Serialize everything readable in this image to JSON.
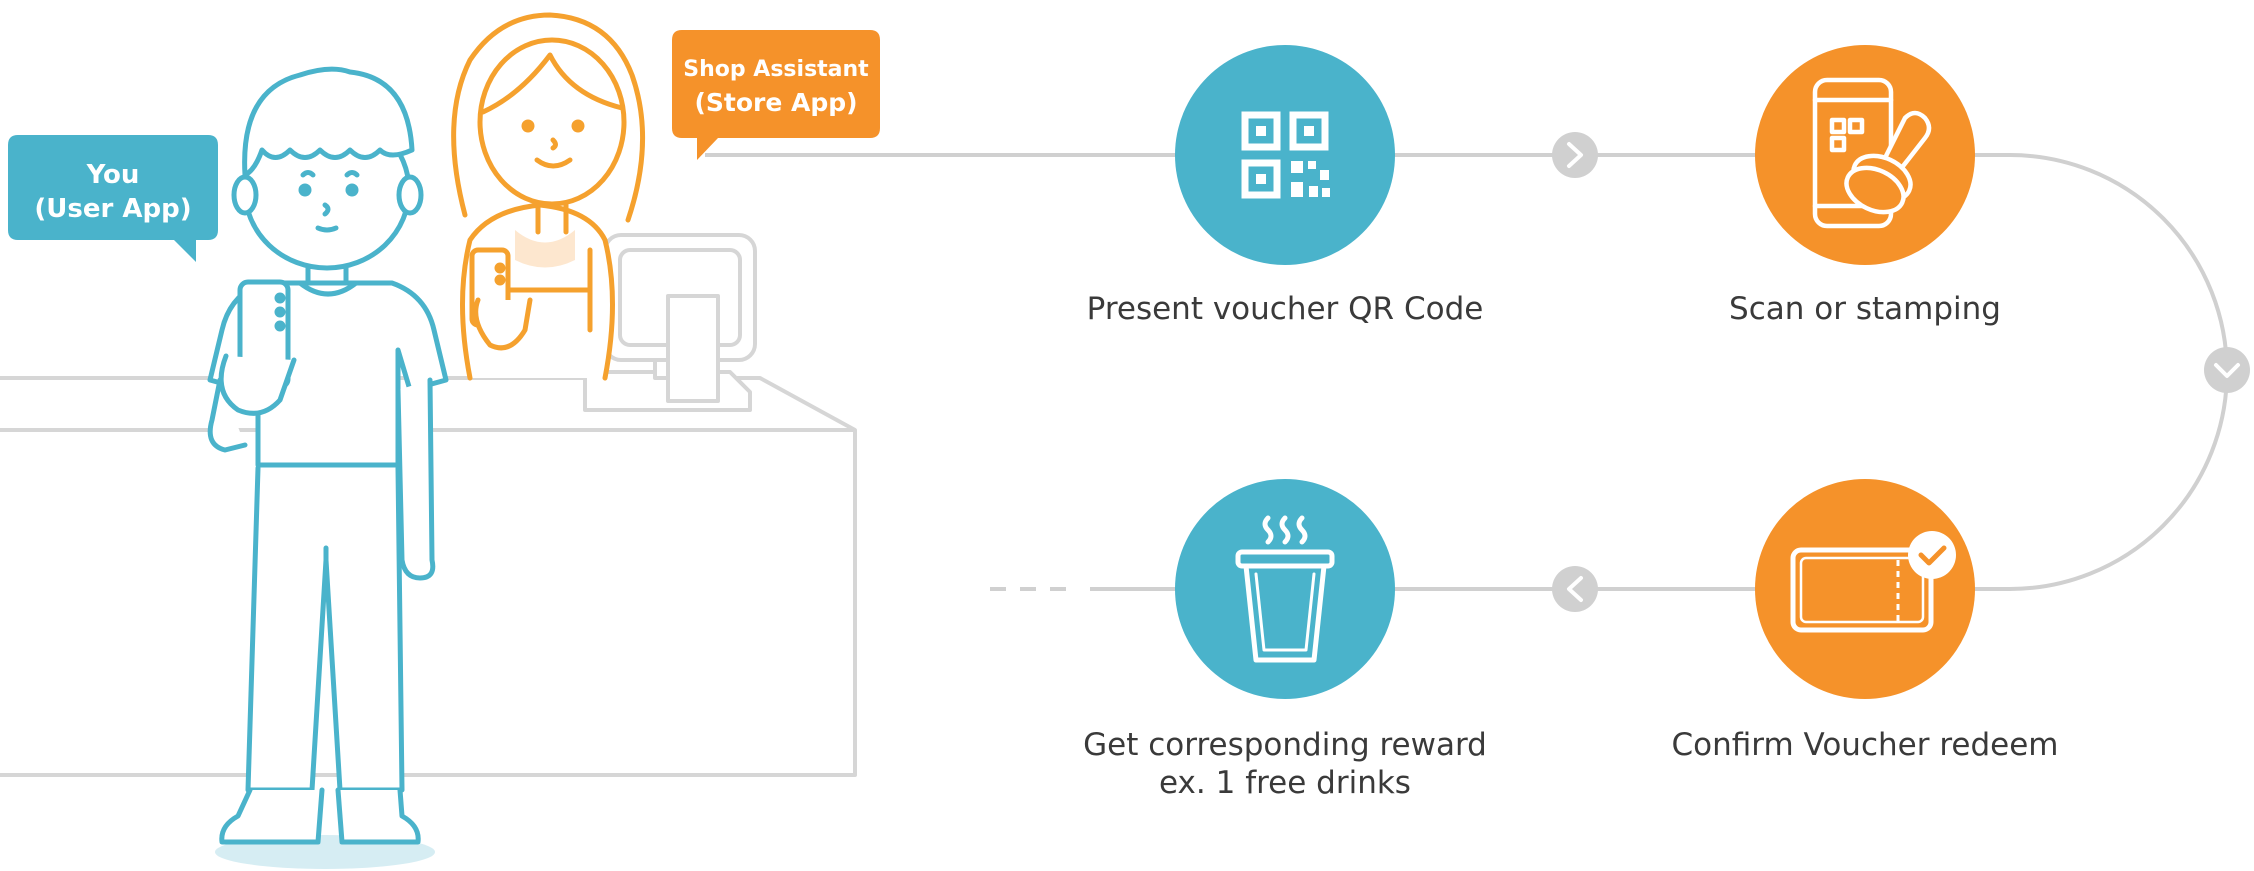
{
  "roles": {
    "user": {
      "line1": "You",
      "line2": "(User App)"
    },
    "shop": {
      "line1": "Shop Assistant",
      "line2": "(Store App)"
    }
  },
  "steps": [
    {
      "label": "Present voucher QR Code",
      "sublabel": "",
      "icon": "qr-code-icon",
      "color": "#4ab3cb"
    },
    {
      "label": "Scan or stamping",
      "sublabel": "",
      "icon": "phone-stamp-icon",
      "color": "#f5922a"
    },
    {
      "label": "Confirm Voucher redeem",
      "sublabel": "",
      "icon": "voucher-check-icon",
      "color": "#f5922a"
    },
    {
      "label": "Get corresponding reward",
      "sublabel": "ex. 1 free drinks",
      "icon": "hot-drink-cup-icon",
      "color": "#4ab3cb"
    }
  ],
  "colors": {
    "teal": "#4ab3cb",
    "orange": "#f5922a",
    "line": "#d0d0d0",
    "text": "#3a3a3a"
  }
}
